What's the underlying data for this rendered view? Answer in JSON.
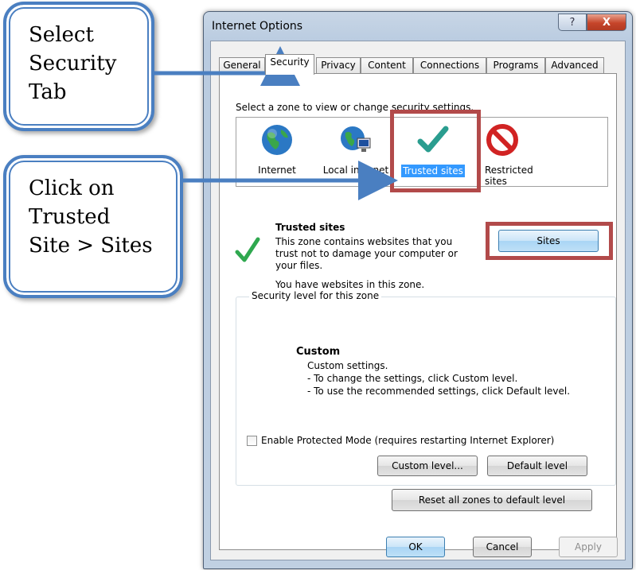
{
  "callouts": {
    "select_security": [
      "Select",
      "Security",
      "Tab"
    ],
    "click_trusted": [
      "Click on",
      "Trusted",
      "Site > Sites"
    ]
  },
  "window": {
    "title": "Internet Options",
    "help_label": "?",
    "close_label": "X"
  },
  "tabs": [
    "General",
    "Security",
    "Privacy",
    "Content",
    "Connections",
    "Programs",
    "Advanced"
  ],
  "active_tab": "Security",
  "zone_prompt": "Select a zone to view or change security settings.",
  "zones": [
    {
      "label": "Internet",
      "icon": "globe-icon"
    },
    {
      "label": "Local intranet",
      "icon": "intranet-globe-icon"
    },
    {
      "label": "Trusted sites",
      "icon": "green-checkmark-icon",
      "selected": true
    },
    {
      "label": "Restricted sites",
      "icon": "prohibited-icon"
    }
  ],
  "zone_info": {
    "title": "Trusted sites",
    "description": "This zone contains websites that you trust not to damage your computer or your files.",
    "status": "You have websites in this zone.",
    "sites_button": "Sites"
  },
  "security_level": {
    "group_label": "Security level for this zone",
    "level_name": "Custom",
    "line1": "Custom settings.",
    "line2": "- To change the settings, click Custom level.",
    "line3": "- To use the recommended settings, click Default level."
  },
  "protected_mode": {
    "label": "Enable Protected Mode (requires restarting Internet Explorer)",
    "checked": false
  },
  "buttons": {
    "custom_level": "Custom level...",
    "default_level": "Default level",
    "reset_all": "Reset all zones to default level",
    "ok": "OK",
    "cancel": "Cancel",
    "apply": "Apply"
  },
  "colors": {
    "callout_border": "#4a7fc1",
    "highlight_red": "#b24a4a",
    "selection_blue": "#3399ff",
    "check_green": "#2fa84f"
  }
}
